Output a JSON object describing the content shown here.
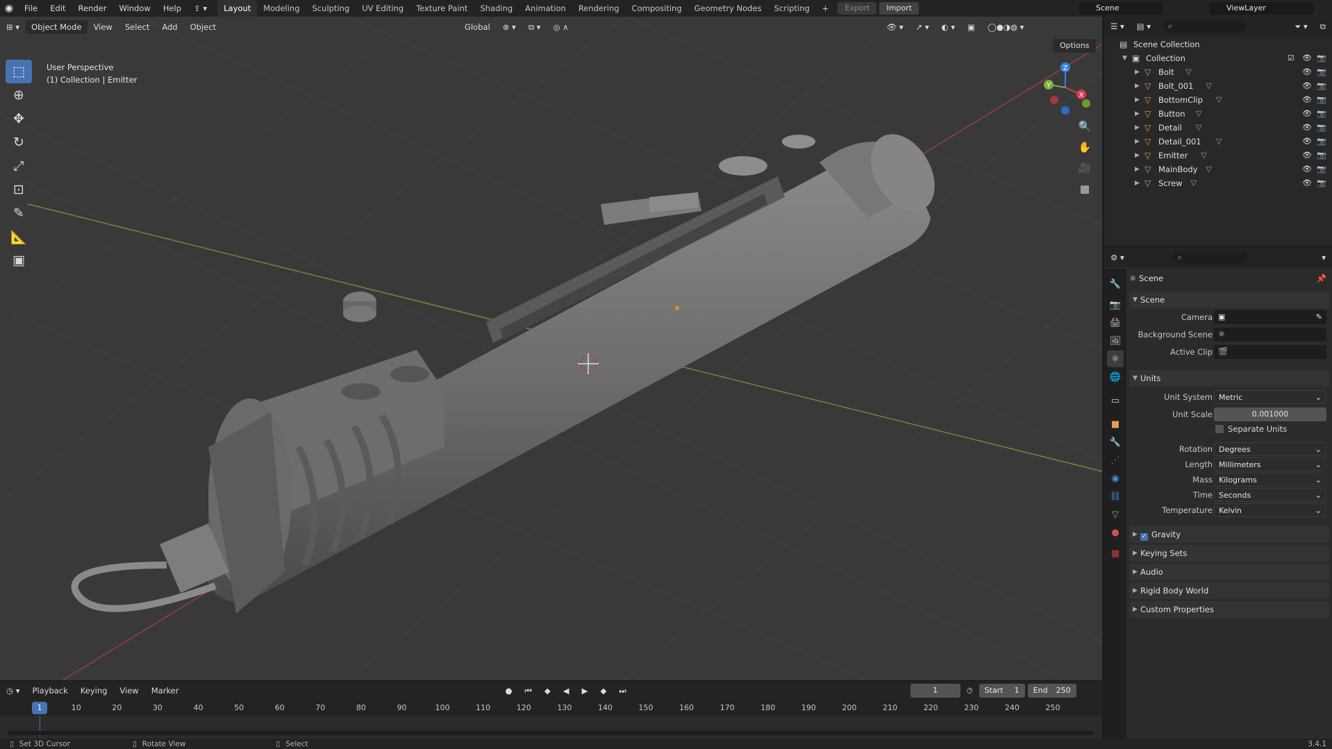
{
  "topbar": {
    "menus": [
      "File",
      "Edit",
      "Render",
      "Window",
      "Help"
    ],
    "workspaces": [
      "Layout",
      "Modeling",
      "Sculpting",
      "UV Editing",
      "Texture Paint",
      "Shading",
      "Animation",
      "Rendering",
      "Compositing",
      "Geometry Nodes",
      "Scripting"
    ],
    "active_workspace": "Layout",
    "export_label": "Export",
    "import_label": "Import",
    "scene_name": "Scene",
    "view_layer": "ViewLayer"
  },
  "viewport": {
    "mode": "Object Mode",
    "menus": [
      "View",
      "Select",
      "Add",
      "Object"
    ],
    "orientation": "Global",
    "options_label": "Options",
    "info_line1": "User Perspective",
    "info_line2": "(1) Collection | Emitter",
    "gizmo_axes": {
      "x": "X",
      "y": "Y",
      "z": "Z"
    }
  },
  "timeline": {
    "menus": [
      "Playback",
      "Keying",
      "View",
      "Marker"
    ],
    "current_frame": "1",
    "start_label": "Start",
    "start_value": "1",
    "end_label": "End",
    "end_value": "250",
    "ticks": [
      "1",
      "10",
      "20",
      "30",
      "40",
      "50",
      "60",
      "70",
      "80",
      "90",
      "100",
      "110",
      "120",
      "130",
      "140",
      "150",
      "160",
      "170",
      "180",
      "190",
      "200",
      "210",
      "220",
      "230",
      "240",
      "250"
    ]
  },
  "statusbar": {
    "left_hint": "Set 3D Cursor",
    "middle_hint": "Rotate View",
    "right_hint": "Select",
    "version": "3.4.1"
  },
  "outliner": {
    "root": "Scene Collection",
    "collection": "Collection",
    "objects": [
      "Bolt",
      "Bolt_001",
      "BottomClip",
      "Button",
      "Detail",
      "Detail_001",
      "Emitter",
      "MainBody",
      "Screw"
    ]
  },
  "properties": {
    "context": "Scene",
    "scene_panel": "Scene",
    "camera_label": "Camera",
    "background_scene_label": "Background Scene",
    "active_clip_label": "Active Clip",
    "units_panel": "Units",
    "unit_system_label": "Unit System",
    "unit_system": "Metric",
    "unit_scale_label": "Unit Scale",
    "unit_scale": "0.001000",
    "separate_units_label": "Separate Units",
    "rotation_label": "Rotation",
    "rotation": "Degrees",
    "length_label": "Length",
    "length": "Millimeters",
    "mass_label": "Mass",
    "mass": "Kilograms",
    "time_label": "Time",
    "time": "Seconds",
    "temperature_label": "Temperature",
    "temperature": "Kelvin",
    "collapsed_panels": [
      "Gravity",
      "Keying Sets",
      "Audio",
      "Rigid Body World",
      "Custom Properties"
    ]
  },
  "colors": {
    "accent": "#4772b3",
    "mesh_icon": "#5ec95e",
    "object_icon": "#e79e5a",
    "axis_x": "#d63c4a",
    "axis_y": "#7fb13b",
    "axis_z": "#2f83e3"
  }
}
